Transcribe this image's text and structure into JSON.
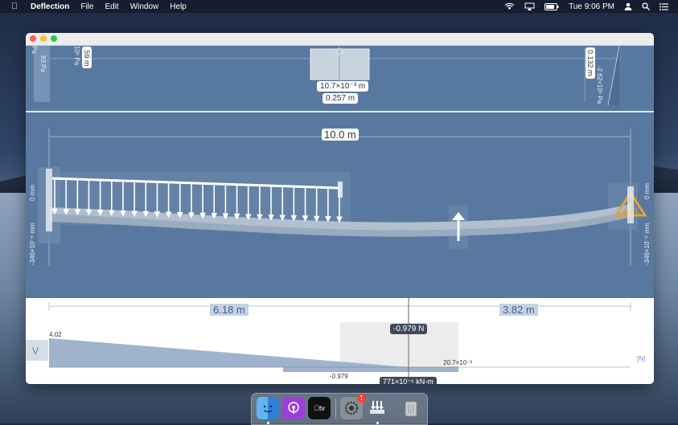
{
  "menubar": {
    "app_name": "Deflection",
    "menus": [
      "File",
      "Edit",
      "Window",
      "Help"
    ],
    "clock": "Tue 9:06 PM"
  },
  "section_view": {
    "left_label_a": "83 Pa",
    "left_label_b": "10⁶ Pa",
    "left_label_c": "Pa",
    "height_label": ".59 m",
    "depth_label": "10.7×10⁻³ m",
    "width_label": "0.257 m",
    "right_height_label": "0.132 m",
    "right_stress_label": "-2.62×10⁶ Pa"
  },
  "beam_view": {
    "span_label": "10.0 m",
    "left_defl_top": "0 mm",
    "left_defl_bottom": "-346×10⁻⁶ mm",
    "right_defl_top": "0 mm",
    "right_defl_bottom": "-346×10⁻⁶ mm"
  },
  "toolbar": {
    "tools": [
      "point-load-tool",
      "moment-tool",
      "distributed-load-tool",
      "pin-support-tool",
      "spring-support-tool",
      "fixed-support-tool",
      "roller-support-tool"
    ]
  },
  "diagram": {
    "left_length": "6.18 m",
    "right_length": "3.82 m",
    "cursor_value": "-0.979 N",
    "moment_value": "771×10⁻⁶ kN-m",
    "diagram_type": "V",
    "unit": "[N]",
    "max_label": "4.02",
    "min_label": "-0.979",
    "small_value": "20.7×10⁻³"
  },
  "dock": {
    "items": [
      "finder-icon",
      "podcasts-icon",
      "apple-tv-icon",
      "system-preferences-icon",
      "deflection-app-icon",
      "trash-icon"
    ],
    "badge": "1"
  },
  "colors": {
    "window_bg": "#58789f",
    "load_arrows": "#ffffff",
    "support_accent": "#e3a23a",
    "shear_fill": "#9fb3cd"
  }
}
